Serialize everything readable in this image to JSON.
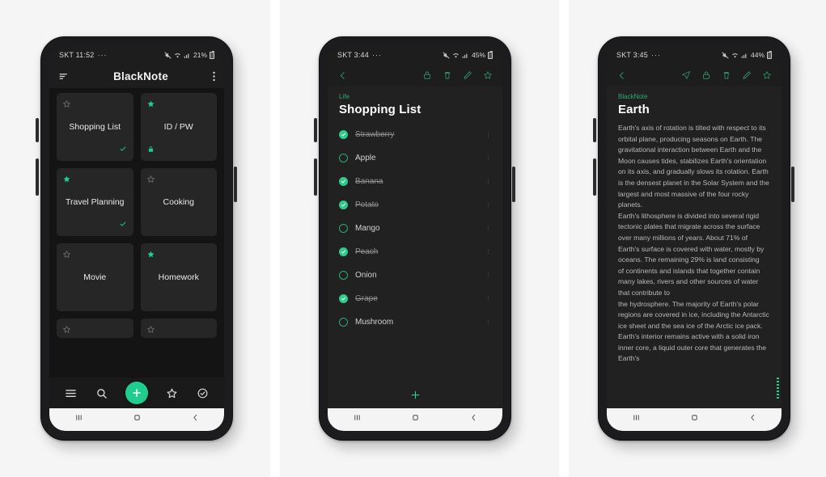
{
  "phone1": {
    "status": {
      "carrier_time": "SKT 11:52",
      "dots": "···",
      "battery": "21%"
    },
    "appbar": {
      "title": "BlackNote",
      "menu_icon": "sort-icon",
      "overflow_icon": "kebab-icon"
    },
    "notes": [
      {
        "label": "Shopping List",
        "starred": false,
        "checked": true,
        "locked": false
      },
      {
        "label": "ID / PW",
        "starred": true,
        "checked": false,
        "locked": true
      },
      {
        "label": "Travel Planning",
        "starred": true,
        "checked": true,
        "locked": false
      },
      {
        "label": "Cooking",
        "starred": false,
        "checked": false,
        "locked": false
      },
      {
        "label": "Movie",
        "starred": false,
        "checked": false,
        "locked": false
      },
      {
        "label": "Homework",
        "starred": true,
        "checked": false,
        "locked": false
      }
    ],
    "bottom_nav": [
      "menu-icon",
      "search-icon",
      "add-fab",
      "star-icon",
      "check-circle-icon"
    ],
    "android_nav": [
      "recents",
      "home",
      "back"
    ]
  },
  "phone2": {
    "status": {
      "carrier_time": "SKT 3:44",
      "dots": "···",
      "battery": "45%"
    },
    "toolbar": {
      "back_icon": "back-chevron-icon",
      "icons": [
        "lock-icon",
        "trash-icon",
        "pencil-icon",
        "star-icon"
      ]
    },
    "category": "Life",
    "title": "Shopping List",
    "items": [
      {
        "text": "Strawberry",
        "done": true
      },
      {
        "text": "Apple",
        "done": false
      },
      {
        "text": "Banana",
        "done": true
      },
      {
        "text": "Potato",
        "done": true
      },
      {
        "text": "Mango",
        "done": false
      },
      {
        "text": "Peach",
        "done": true
      },
      {
        "text": "Onion",
        "done": false
      },
      {
        "text": "Grape",
        "done": true
      },
      {
        "text": "Mushroom",
        "done": false
      }
    ],
    "add_label": "+",
    "android_nav": [
      "recents",
      "home",
      "back"
    ]
  },
  "phone3": {
    "status": {
      "carrier_time": "SKT 3:45",
      "dots": "···",
      "battery": "44%"
    },
    "toolbar": {
      "back_icon": "back-chevron-icon",
      "icons": [
        "send-icon",
        "lock-icon",
        "trash-icon",
        "pencil-icon",
        "star-icon"
      ]
    },
    "category": "BlackNote",
    "title": "Earth",
    "body": "Earth's axis of rotation is tilted with respect to its orbital plane, producing seasons on Earth. The gravitational interaction between Earth and the Moon causes tides, stabilizes Earth's orientation on its axis, and gradually slows its rotation. Earth is the densest planet in the Solar System and the largest and most massive of the four rocky planets.\nEarth's lithosphere is divided into several rigid tectonic plates that migrate across the surface over many millions of years. About 71% of Earth's surface is covered with water, mostly by oceans. The remaining 29% is land consisting\nof continents and islands that together contain many lakes, rivers and other sources of water that contribute to\nthe hydrosphere. The majority of Earth's polar regions are covered in ice, including the Antarctic ice sheet and the sea ice of the Arctic ice pack. Earth's interior remains active with a solid iron inner core, a liquid outer core that generates the Earth's",
    "android_nav": [
      "recents",
      "home",
      "back"
    ]
  },
  "colors": {
    "accent": "#1fce8f",
    "accent_dark": "#2e8b62",
    "screen_bg": "#141414",
    "card": "#262626",
    "note_bg": "#212121"
  }
}
